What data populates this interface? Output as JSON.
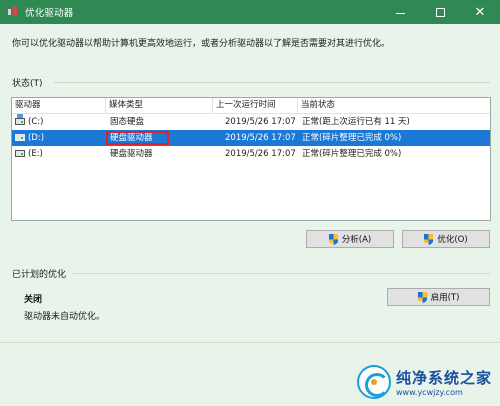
{
  "window": {
    "title": "优化驱动器",
    "icon": "defrag-app-icon"
  },
  "description": "你可以优化驱动器以帮助计算机更高效地运行，或者分析驱动器以了解是否需要对其进行优化。",
  "status_section": {
    "label": "状态(T)"
  },
  "drives_table": {
    "columns": [
      "驱动器",
      "媒体类型",
      "上一次运行时间",
      "当前状态"
    ],
    "rows": [
      {
        "drive": "(C:)",
        "media": "固态硬盘",
        "last_run": "2019/5/26 17:07",
        "status": "正常(距上次运行已有 11 天)"
      },
      {
        "drive": "(D:)",
        "media": "硬盘驱动器",
        "last_run": "2019/5/26 17:07",
        "status": "正常(碎片整理已完成 0%)"
      },
      {
        "drive": "(E:)",
        "media": "硬盘驱动器",
        "last_run": "2019/5/26 17:07",
        "status": "正常(碎片整理已完成 0%)"
      }
    ],
    "selected_index": 1
  },
  "buttons": {
    "analyze": "分析(A)",
    "optimize": "优化(O)",
    "enable": "启用(T)"
  },
  "scheduled_section": {
    "label": "已计划的优化",
    "status_title": "关闭",
    "status_desc": "驱动器未自动优化。"
  },
  "watermark": {
    "name": "纯净系统之家",
    "url": "www.ycwjzy.com"
  },
  "colors": {
    "titlebar": "#2e8a52",
    "background": "#e8f3e9",
    "selection": "#1b78d4",
    "highlight_box": "#e0202a"
  }
}
